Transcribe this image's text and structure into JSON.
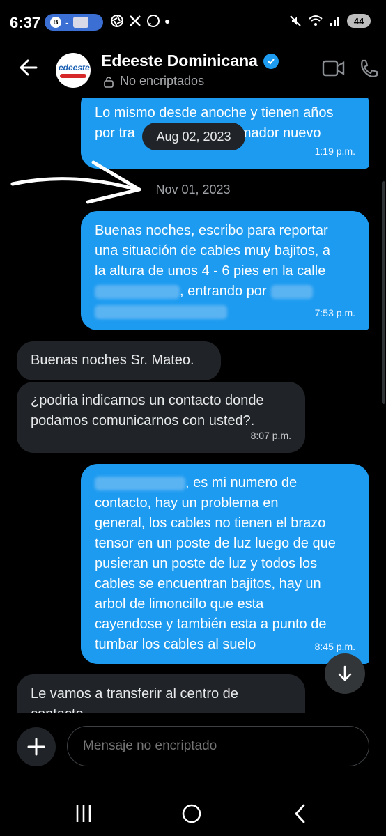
{
  "status_bar": {
    "time": "6:37",
    "pill_separator": "-",
    "battery": "44"
  },
  "header": {
    "title": "Edeeste Dominicana",
    "subtitle": "No encriptados",
    "avatar_text": "edeeste"
  },
  "messages": {
    "m0": {
      "text_a": "Lo mismo desde anoche y tienen años",
      "text_b": "por tra",
      "text_c": "mador nuevo",
      "time": "1:19 p.m."
    },
    "date_chip": "Aug 02, 2023",
    "date_separator": "Nov 01, 2023",
    "m1": {
      "l1": "Buenas noches, escribo para reportar",
      "l2": "una situación de cables muy bajitos, a",
      "l3": "la altura de unos 4 - 6 pies en la calle",
      "l4": ", entrando por",
      "time": "7:53 p.m."
    },
    "m2": {
      "text": "Buenas noches Sr. Mateo."
    },
    "m3": {
      "l1": "¿podria indicarnos un contacto donde",
      "l2": "podamos comunicarnos con usted?.",
      "time": "8:07 p.m."
    },
    "m4": {
      "l1": ", es mi numero de",
      "l2": "contacto, hay un problema en",
      "l3": "general, los cables no tienen el brazo",
      "l4": "tensor en un poste de luz luego de que",
      "l5": "pusieran un poste de luz y todos los",
      "l6": "cables se encuentran bajitos, hay un",
      "l7": "arbol de limoncillo que esta",
      "l8": "cayendose y también esta a punto de",
      "l9": "tumbar los cables al suelo",
      "time": "8:45 p.m."
    },
    "m5": {
      "l1": "Le vamos a transferir al centro de",
      "l2": "contacto"
    }
  },
  "composer": {
    "placeholder": "Mensaje no encriptado"
  },
  "colors": {
    "accent": "#1d9bf0",
    "incoming": "#202327",
    "background": "#000000"
  },
  "icons": [
    "back-arrow-icon",
    "verified-icon",
    "lock-icon",
    "video-call-icon",
    "phone-icon",
    "scroll-down-icon",
    "plus-icon",
    "recents-icon",
    "home-icon",
    "nav-back-icon",
    "annotation-arrow"
  ]
}
